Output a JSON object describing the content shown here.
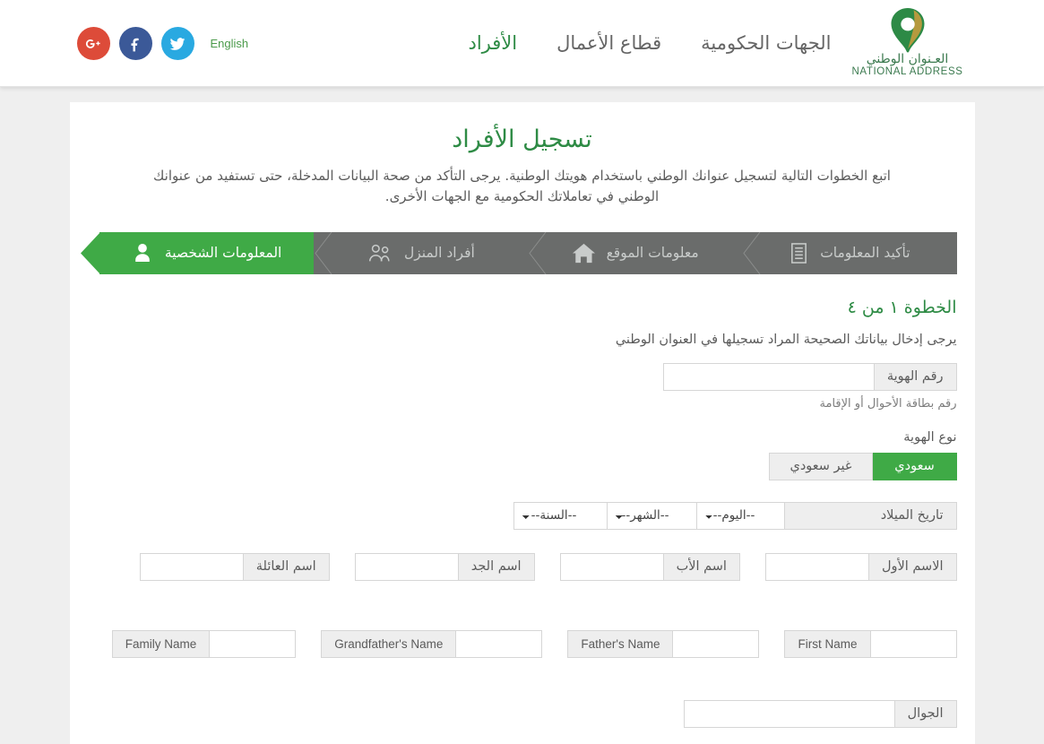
{
  "header": {
    "social": [
      {
        "name": "google-plus",
        "label": "G+",
        "color": "#dd4b39"
      },
      {
        "name": "facebook",
        "label": "f",
        "color": "#3b5998"
      },
      {
        "name": "twitter",
        "label": "t",
        "color": "#29a9e1"
      }
    ],
    "language_link": "English",
    "nav": [
      {
        "label": "الجهات الحكومية",
        "active": false
      },
      {
        "label": "قطاع الأعمال",
        "active": false
      },
      {
        "label": "الأفراد",
        "active": true
      }
    ],
    "brand": {
      "arabic": "العـنوان الوطني",
      "english": "NATIONAL ADDRESS"
    }
  },
  "page": {
    "title": "تسجيل الأفراد",
    "description": "اتبع الخطوات التالية لتسجيل عنوانك الوطني باستخدام هويتك الوطنية. يرجى التأكد من صحة البيانات المدخلة، حتى تستفيد من عنوانك الوطني في تعاملاتك الحكومية مع الجهات الأخرى."
  },
  "stepper": {
    "steps": [
      {
        "label": "تأكيد المعلومات",
        "icon": "document-icon",
        "active": false
      },
      {
        "label": "معلومات الموقع",
        "icon": "home-icon",
        "active": false
      },
      {
        "label": "أفراد المنزل",
        "icon": "group-icon",
        "active": false
      },
      {
        "label": "المعلومات الشخصية",
        "icon": "person-icon",
        "active": true
      }
    ]
  },
  "form": {
    "step_heading": "الخطوة ١  من ٤",
    "note": "يرجى إدخال بياناتك الصحيحة المراد تسجيلها في العنوان الوطني",
    "id_number": {
      "label": "رقم الهوية",
      "value": "",
      "placeholder": "",
      "help": "رقم بطاقة الأحوال أو الإقامة"
    },
    "id_type": {
      "label": "نوع الهوية",
      "options": [
        {
          "label": "سعودي",
          "selected": true
        },
        {
          "label": "غير سعودي",
          "selected": false
        }
      ]
    },
    "birth_date": {
      "label": "تاريخ الميلاد",
      "day": "--اليوم--",
      "month": "--الشهر--",
      "year": "--السنة--"
    },
    "arabic_names": [
      {
        "label": "الاسم الأول",
        "value": ""
      },
      {
        "label": "اسم الأب",
        "value": ""
      },
      {
        "label": "اسم الجد",
        "value": ""
      },
      {
        "label": "اسم العائلة",
        "value": ""
      }
    ],
    "english_names": [
      {
        "label": "First Name",
        "value": ""
      },
      {
        "label": "Father's Name",
        "value": ""
      },
      {
        "label": "Grandfather's Name",
        "value": ""
      },
      {
        "label": "Family Name",
        "value": ""
      }
    ],
    "mobile": {
      "label": "الجوال",
      "value": ""
    }
  },
  "colors": {
    "green": "#3faa46",
    "dark_green": "#2e8b45",
    "stepper_gray": "#6a6c6b",
    "page_bg": "#efefef"
  }
}
